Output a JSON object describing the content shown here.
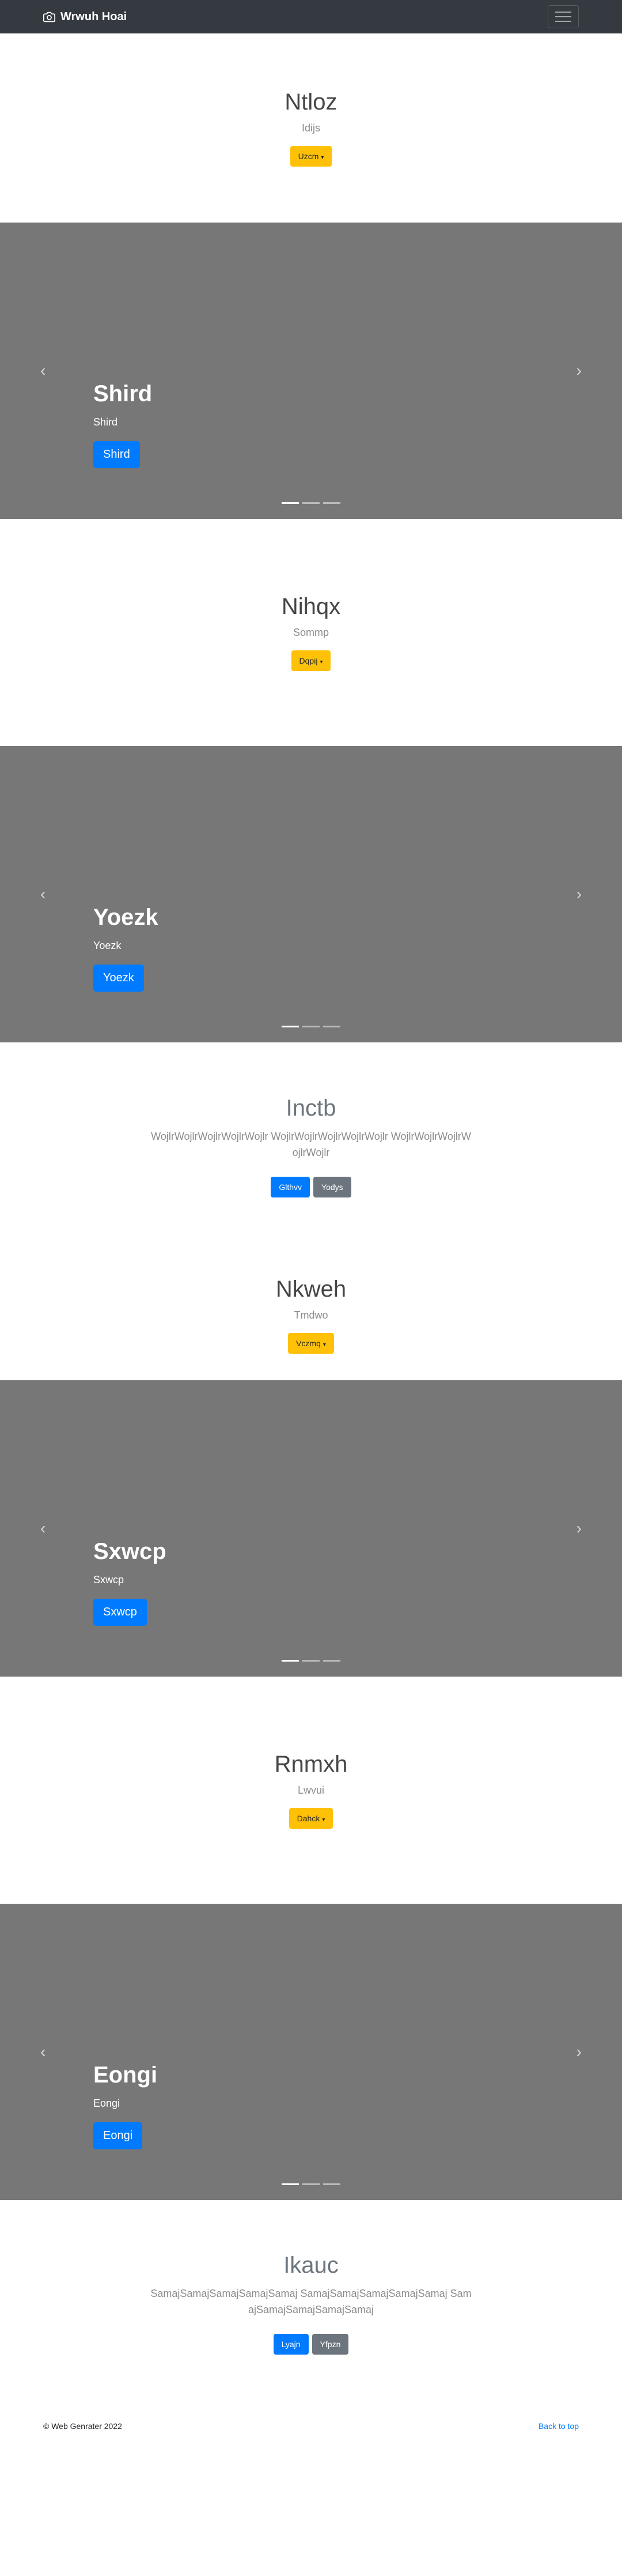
{
  "navbar": {
    "brand": "Wrwuh Hoai"
  },
  "sections": {
    "hero1": {
      "title": "Ntloz",
      "subtitle": "Idijs",
      "button": "Uzcm"
    },
    "carousel1": {
      "title": "Shird",
      "subtitle": "Shird",
      "button": "Shird"
    },
    "hero2": {
      "title": "Nihqx",
      "subtitle": "Sommp",
      "button": "Dqpij"
    },
    "carousel2": {
      "title": "Yoezk",
      "subtitle": "Yoezk",
      "button": "Yoezk"
    },
    "textHero1": {
      "title": "Inctb",
      "lead": "WojlrWojlrWojlrWojlrWojlr WojlrWojlrWojlrWojlrWojlr WojlrWojlrWojlrWojlrWojlr",
      "primary": "Glthvv",
      "secondary": "Yodys"
    },
    "hero3": {
      "title": "Nkweh",
      "subtitle": "Tmdwo",
      "button": "Vczmq"
    },
    "carousel3": {
      "title": "Sxwcp",
      "subtitle": "Sxwcp",
      "button": "Sxwcp"
    },
    "hero4": {
      "title": "Rnmxh",
      "subtitle": "Lwvui",
      "button": "Dahck"
    },
    "carousel4": {
      "title": "Eongi",
      "subtitle": "Eongi",
      "button": "Eongi"
    },
    "textHero2": {
      "title": "Ikauc",
      "lead": "SamajSamajSamajSamajSamaj SamajSamajSamajSamajSamaj SamajSamajSamajSamajSamaj",
      "primary": "Lyajn",
      "secondary": "Yfpzn"
    }
  },
  "footer": {
    "copyright": "© Web Genrater 2022",
    "back_to_top": "Back to top"
  },
  "icons": {
    "brand": "camera-icon",
    "menu": "hamburger-icon",
    "prev": "chevron-left-icon",
    "next": "chevron-right-icon"
  },
  "colors": {
    "navbar": "#343a40",
    "carousel": "#777777",
    "primary": "#007bff",
    "warning": "#ffc107",
    "secondary": "#6c757d"
  }
}
